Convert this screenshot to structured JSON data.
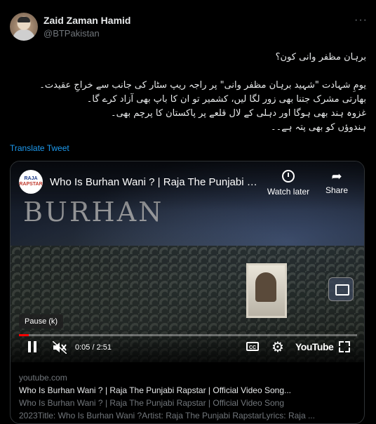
{
  "author": {
    "name": "Zaid Zaman Hamid",
    "handle": "@BTPakistan",
    "more_label": "···"
  },
  "tweet": {
    "lines": [
      "برہان مظفر وانی کون؟",
      "",
      "یومِ شہادت \"شہید برہان مظفر وانی\" پر راجہ ریپ سٹار کی جانب سے خراجِ عقیدت۔",
      "بھارتی مشرک جتنا بھی زور لگا لیں، کشمیر تو ان کا باپ بھی آزاد کرے گا۔",
      "غزوہ ہند بھی ہوگا اور دہلی کے لال قلعے پر پاکستان کا پرچم بھی۔",
      "ہندوؤں کو بھی پتہ ہے۔۔"
    ],
    "translate_label": "Translate Tweet"
  },
  "video": {
    "channel_logo_text_1": "RAJA",
    "channel_logo_text_2": "RAPSTAR",
    "title": "Who Is Burhan Wani ? | Raja The Punjabi Rapstar | Official Video Song",
    "overlay_text": "BURHAN",
    "watch_later_label": "Watch later",
    "share_label": "Share",
    "pause_tooltip": "Pause (k)",
    "time": "0:05 / 2:51",
    "progress": 0.03,
    "cc_label": "CC",
    "youtube_label": "YouTube",
    "progress_color": "#ff0000"
  },
  "link": {
    "domain": "youtube.com",
    "title": "Who Is Burhan Wani ? | Raja The Punjabi Rapstar | Official Video Song...",
    "desc_line_1": "Who Is Burhan Wani ? | Raja The Punjabi Rapstar | Official Video Song",
    "desc_line_2": "2023Title: Who Is Burhan Wani ?Artist: Raja The Punjabi RapstarLyrics: Raja ..."
  },
  "colors": {
    "background": "#000000",
    "text": "#e7e9ea",
    "muted": "#71767b",
    "link": "#1d9bf0"
  }
}
